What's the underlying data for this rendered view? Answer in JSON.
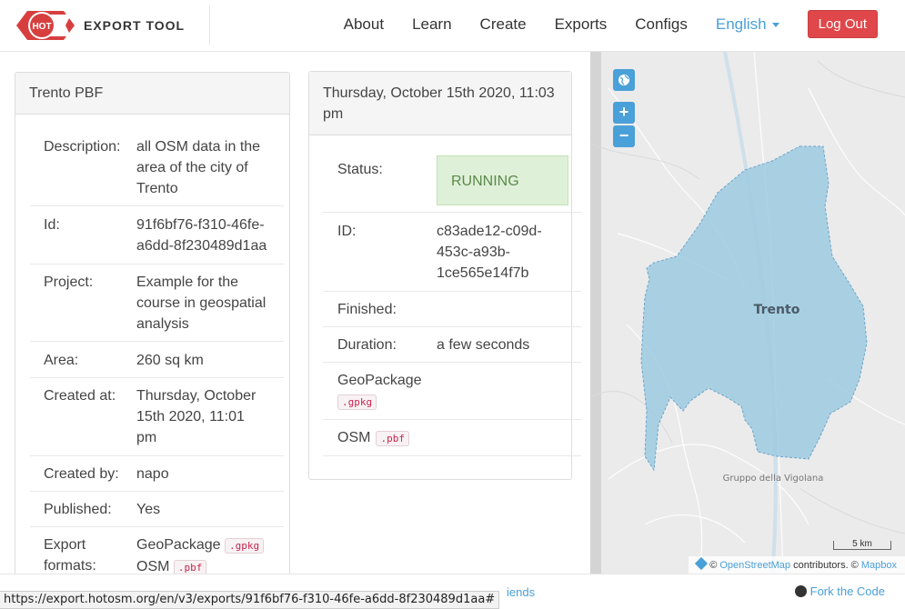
{
  "nav": {
    "brand_badge": "HOT",
    "brand_text": "EXPORT TOOL",
    "about": "About",
    "learn": "Learn",
    "create": "Create",
    "exports": "Exports",
    "configs": "Configs",
    "language": "English",
    "logout": "Log Out"
  },
  "export_panel": {
    "title": "Trento PBF",
    "description_label": "Description:",
    "description": "all OSM data in the area of the city of Trento",
    "id_label": "Id:",
    "id": "91f6bf76-f310-46fe-a6dd-8f230489d1aa",
    "project_label": "Project:",
    "project": "Example for the course in geospatial analysis",
    "area_label": "Area:",
    "area": "260 sq km",
    "created_at_label": "Created at:",
    "created_at": "Thursday, October 15th 2020, 11:01 pm",
    "created_by_label": "Created by:",
    "created_by": "napo",
    "published_label": "Published:",
    "published": "Yes",
    "formats_label": "Export formats:",
    "format_1": "GeoPackage",
    "format_1_ext": ".gpkg",
    "format_2": "OSM",
    "format_2_ext": ".pbf"
  },
  "run_panel": {
    "title": "Thursday, October 15th 2020, 11:03 pm",
    "status_label": "Status:",
    "status": "RUNNING",
    "id_label": "ID:",
    "id": "c83ade12-c09d-453c-a93b-1ce565e14f7b",
    "finished_label": "Finished:",
    "finished": "",
    "duration_label": "Duration:",
    "duration": "a few seconds",
    "file_1": "GeoPackage",
    "file_1_ext": ".gpkg",
    "file_2": "OSM",
    "file_2_ext": ".pbf"
  },
  "map": {
    "city_label": "Trento",
    "mountain_label": "Gruppo della Vigolana",
    "scale": "5 km",
    "attrib_prefix": "©",
    "attrib_osm": "OpenStreetMap",
    "attrib_mid": "contributors. ©",
    "attrib_mapbox": "Mapbox",
    "zoom_in": "+",
    "zoom_out": "−"
  },
  "footer": {
    "friends": "iends",
    "fork": "Fork the Code"
  },
  "status_bar_url": "https://export.hotosm.org/en/v3/exports/91f6bf76-f310-46fe-a6dd-8f230489d1aa#",
  "colors": {
    "accent": "#4aa0d8",
    "logout": "#e0474a",
    "running_bg": "#dff0d8",
    "brand_red": "#d73f3f",
    "aoi_fill": "#9ecae1"
  }
}
